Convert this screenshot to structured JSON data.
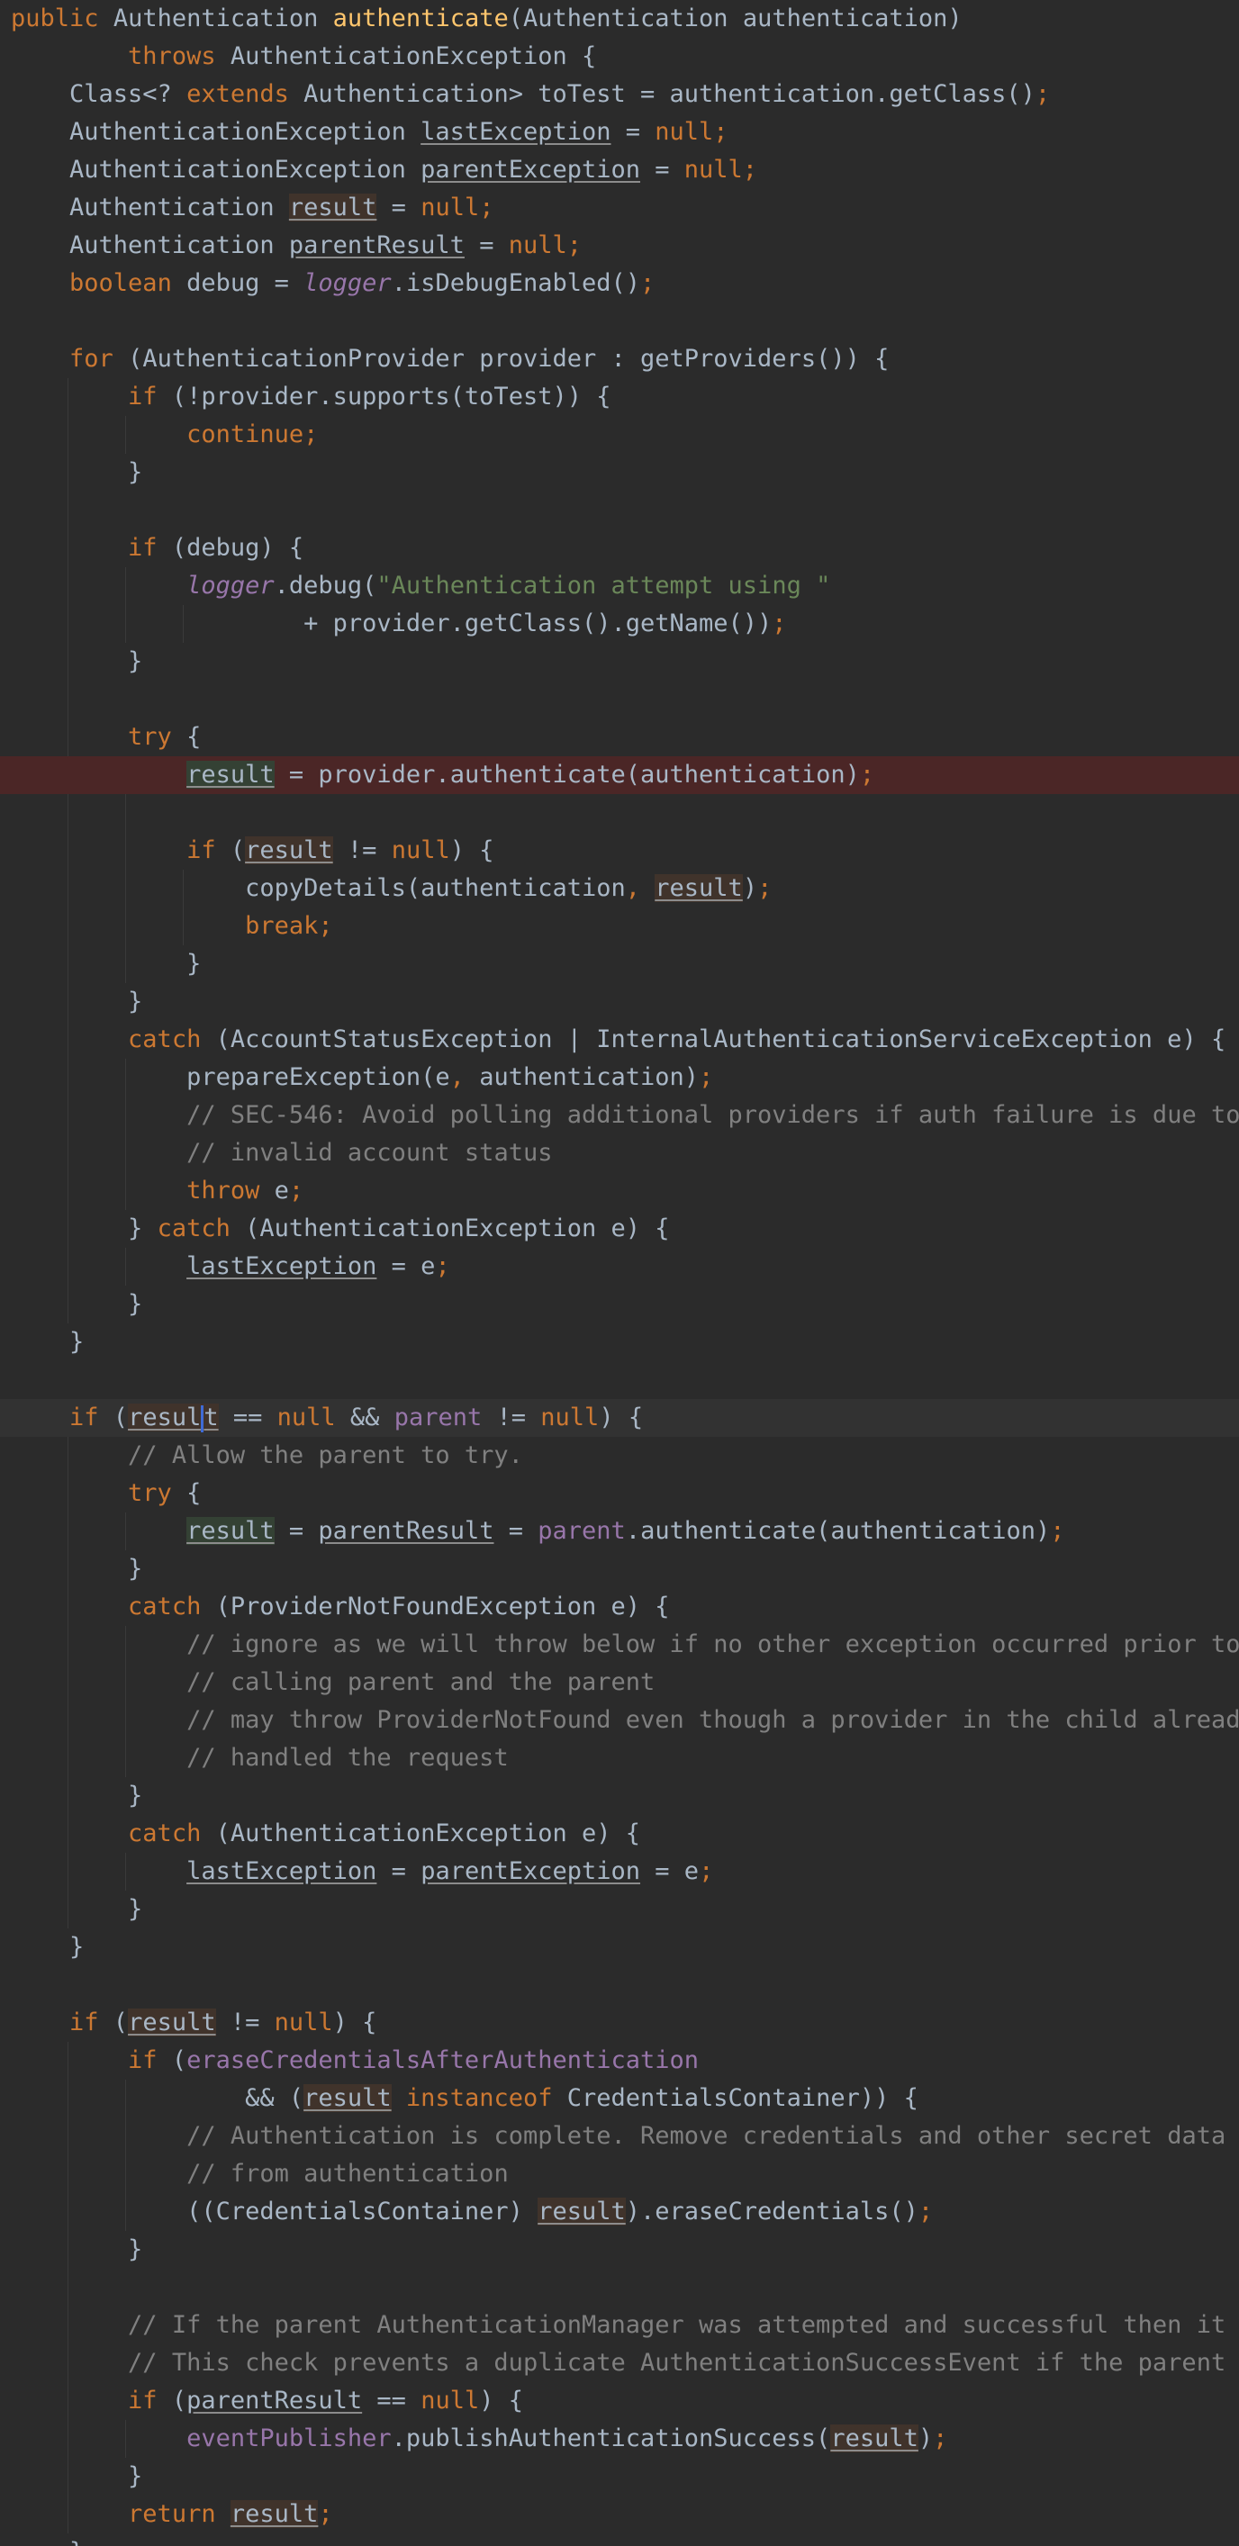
{
  "editor": {
    "language": "java",
    "colors": {
      "background": "#2b2b2b",
      "text": "#a9b7c6",
      "keyword": "#cc7832",
      "method_declaration": "#ffc66d",
      "literal": "#6897bb",
      "string": "#6a8759",
      "comment": "#808080",
      "field": "#9876aa",
      "error_line": "#4b2626",
      "write_usage": "#344134",
      "read_usage": "#40332b",
      "caret": "#3f6bd6"
    },
    "lines": [
      {
        "line": 1,
        "tokens": [
          [
            "kw",
            "public"
          ],
          [
            "",
            "Authentication"
          ],
          [
            "fn",
            "authenticate"
          ],
          [
            "",
            "(Authentication authentication)"
          ]
        ],
        "text": "public Authentication authenticate(Authentication authentication)"
      },
      {
        "line": 2,
        "tokens": [
          [
            "kw",
            "throws"
          ],
          [
            "",
            "AuthenticationException {"
          ]
        ],
        "text": "throws AuthenticationException {"
      },
      {
        "line": 3,
        "text": "Class<? extends Authentication> toTest = authentication.getClass();"
      },
      {
        "line": 4,
        "text": "AuthenticationException lastException = null;"
      },
      {
        "line": 5,
        "text": "AuthenticationException parentException = null;"
      },
      {
        "line": 6,
        "text": "Authentication result = null;"
      },
      {
        "line": 7,
        "text": "Authentication parentResult = null;"
      },
      {
        "line": 8,
        "text": "boolean debug = logger.isDebugEnabled();"
      },
      {
        "line": 9,
        "text": ""
      },
      {
        "line": 10,
        "text": "for (AuthenticationProvider provider : getProviders()) {"
      },
      {
        "line": 11,
        "text": "if (!provider.supports(toTest)) {"
      },
      {
        "line": 12,
        "text": "continue;"
      },
      {
        "line": 13,
        "text": "}"
      },
      {
        "line": 14,
        "text": ""
      },
      {
        "line": 15,
        "text": "if (debug) {"
      },
      {
        "line": 16,
        "text": "logger.debug(\"Authentication attempt using \""
      },
      {
        "line": 17,
        "text": "+ provider.getClass().getName());"
      },
      {
        "line": 18,
        "text": "}"
      },
      {
        "line": 19,
        "text": ""
      },
      {
        "line": 20,
        "text": "try {"
      },
      {
        "line": 21,
        "text": "result = provider.authenticate(authentication);",
        "state": "error"
      },
      {
        "line": 22,
        "text": ""
      },
      {
        "line": 23,
        "text": "if (result != null) {"
      },
      {
        "line": 24,
        "text": "copyDetails(authentication, result);"
      },
      {
        "line": 25,
        "text": "break;"
      },
      {
        "line": 26,
        "text": "}"
      },
      {
        "line": 27,
        "text": "}"
      },
      {
        "line": 28,
        "text": "catch (AccountStatusException | InternalAuthenticationServiceException e) {"
      },
      {
        "line": 29,
        "text": "prepareException(e, authentication);"
      },
      {
        "line": 30,
        "text": "// SEC-546: Avoid polling additional providers if auth failure is due to"
      },
      {
        "line": 31,
        "text": "// invalid account status"
      },
      {
        "line": 32,
        "text": "throw e;"
      },
      {
        "line": 33,
        "text": "} catch (AuthenticationException e) {"
      },
      {
        "line": 34,
        "text": "lastException = e;"
      },
      {
        "line": 35,
        "text": "}"
      },
      {
        "line": 36,
        "text": "}"
      },
      {
        "line": 37,
        "text": ""
      },
      {
        "line": 38,
        "text": "if (result == null && parent != null) {",
        "state": "caret"
      },
      {
        "line": 39,
        "text": "// Allow the parent to try."
      },
      {
        "line": 40,
        "text": "try {"
      },
      {
        "line": 41,
        "text": "result = parentResult = parent.authenticate(authentication);"
      },
      {
        "line": 42,
        "text": "}"
      },
      {
        "line": 43,
        "text": "catch (ProviderNotFoundException e) {"
      },
      {
        "line": 44,
        "text": "// ignore as we will throw below if no other exception occurred prior to"
      },
      {
        "line": 45,
        "text": "// calling parent and the parent"
      },
      {
        "line": 46,
        "text": "// may throw ProviderNotFound even though a provider in the child already"
      },
      {
        "line": 47,
        "text": "// handled the request"
      },
      {
        "line": 48,
        "text": "}"
      },
      {
        "line": 49,
        "text": "catch (AuthenticationException e) {"
      },
      {
        "line": 50,
        "text": "lastException = parentException = e;"
      },
      {
        "line": 51,
        "text": "}"
      },
      {
        "line": 52,
        "text": "}"
      },
      {
        "line": 53,
        "text": ""
      },
      {
        "line": 54,
        "text": "if (result != null) {"
      },
      {
        "line": 55,
        "text": "if (eraseCredentialsAfterAuthentication"
      },
      {
        "line": 56,
        "text": "&& (result instanceof CredentialsContainer)) {"
      },
      {
        "line": 57,
        "text": "// Authentication is complete. Remove credentials and other secret data"
      },
      {
        "line": 58,
        "text": "// from authentication"
      },
      {
        "line": 59,
        "text": "((CredentialsContainer) result).eraseCredentials();"
      },
      {
        "line": 60,
        "text": "}"
      },
      {
        "line": 61,
        "text": ""
      },
      {
        "line": 62,
        "text": "// If the parent AuthenticationManager was attempted and successful then it wi"
      },
      {
        "line": 63,
        "text": "// This check prevents a duplicate AuthenticationSuccessEvent if the parent Au"
      },
      {
        "line": 64,
        "text": "if (parentResult == null) {"
      },
      {
        "line": 65,
        "text": "eventPublisher.publishAuthenticationSuccess(result);"
      },
      {
        "line": 66,
        "text": "}"
      },
      {
        "line": 67,
        "text": "return result;"
      },
      {
        "line": 68,
        "text": "}"
      }
    ]
  }
}
